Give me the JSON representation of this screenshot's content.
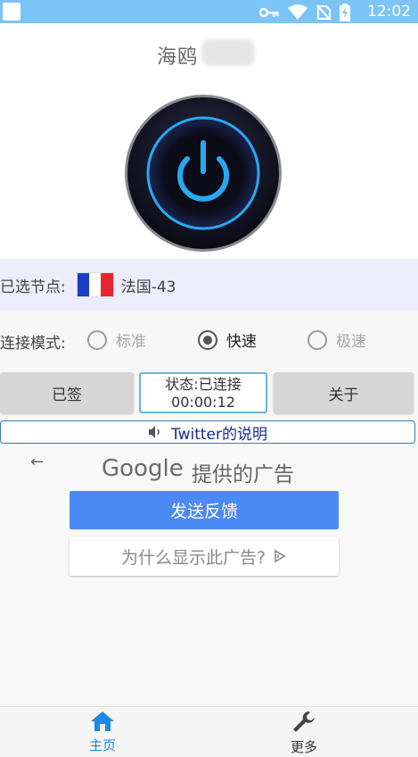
{
  "statusbar": {
    "time": "12:02",
    "icons": [
      "key-icon",
      "wifi-icon",
      "no-sim-icon",
      "battery-charging-icon"
    ],
    "bg_color": "#7cc4f5"
  },
  "app": {
    "title": "海鸥"
  },
  "power_button": {
    "icon": "power-icon",
    "glow_color": "#27a9f2"
  },
  "node": {
    "label": "已选节点:",
    "flag": "france-flag",
    "name": "法国-43"
  },
  "mode": {
    "label": "连接模式:",
    "options": [
      {
        "label": "标准",
        "checked": false
      },
      {
        "label": "快速",
        "checked": true
      },
      {
        "label": "极速",
        "checked": false
      }
    ]
  },
  "actions": {
    "signin_label": "已签",
    "status_line": "状态:已连接",
    "timer": "00:00:12",
    "about_label": "关于"
  },
  "notice": {
    "icon": "speaker-icon",
    "text": "Twitter的说明"
  },
  "ad": {
    "back_icon": "arrow-left-icon",
    "brand": "Google",
    "title": "提供的广告",
    "feedback_label": "发送反馈",
    "why_label": "为什么显示此广告?",
    "why_icon": "adchoices-icon",
    "feedback_color": "#4b8af2"
  },
  "tabs": [
    {
      "label": "主页",
      "icon": "home-icon",
      "active": true
    },
    {
      "label": "更多",
      "icon": "wrench-icon",
      "active": false
    }
  ]
}
